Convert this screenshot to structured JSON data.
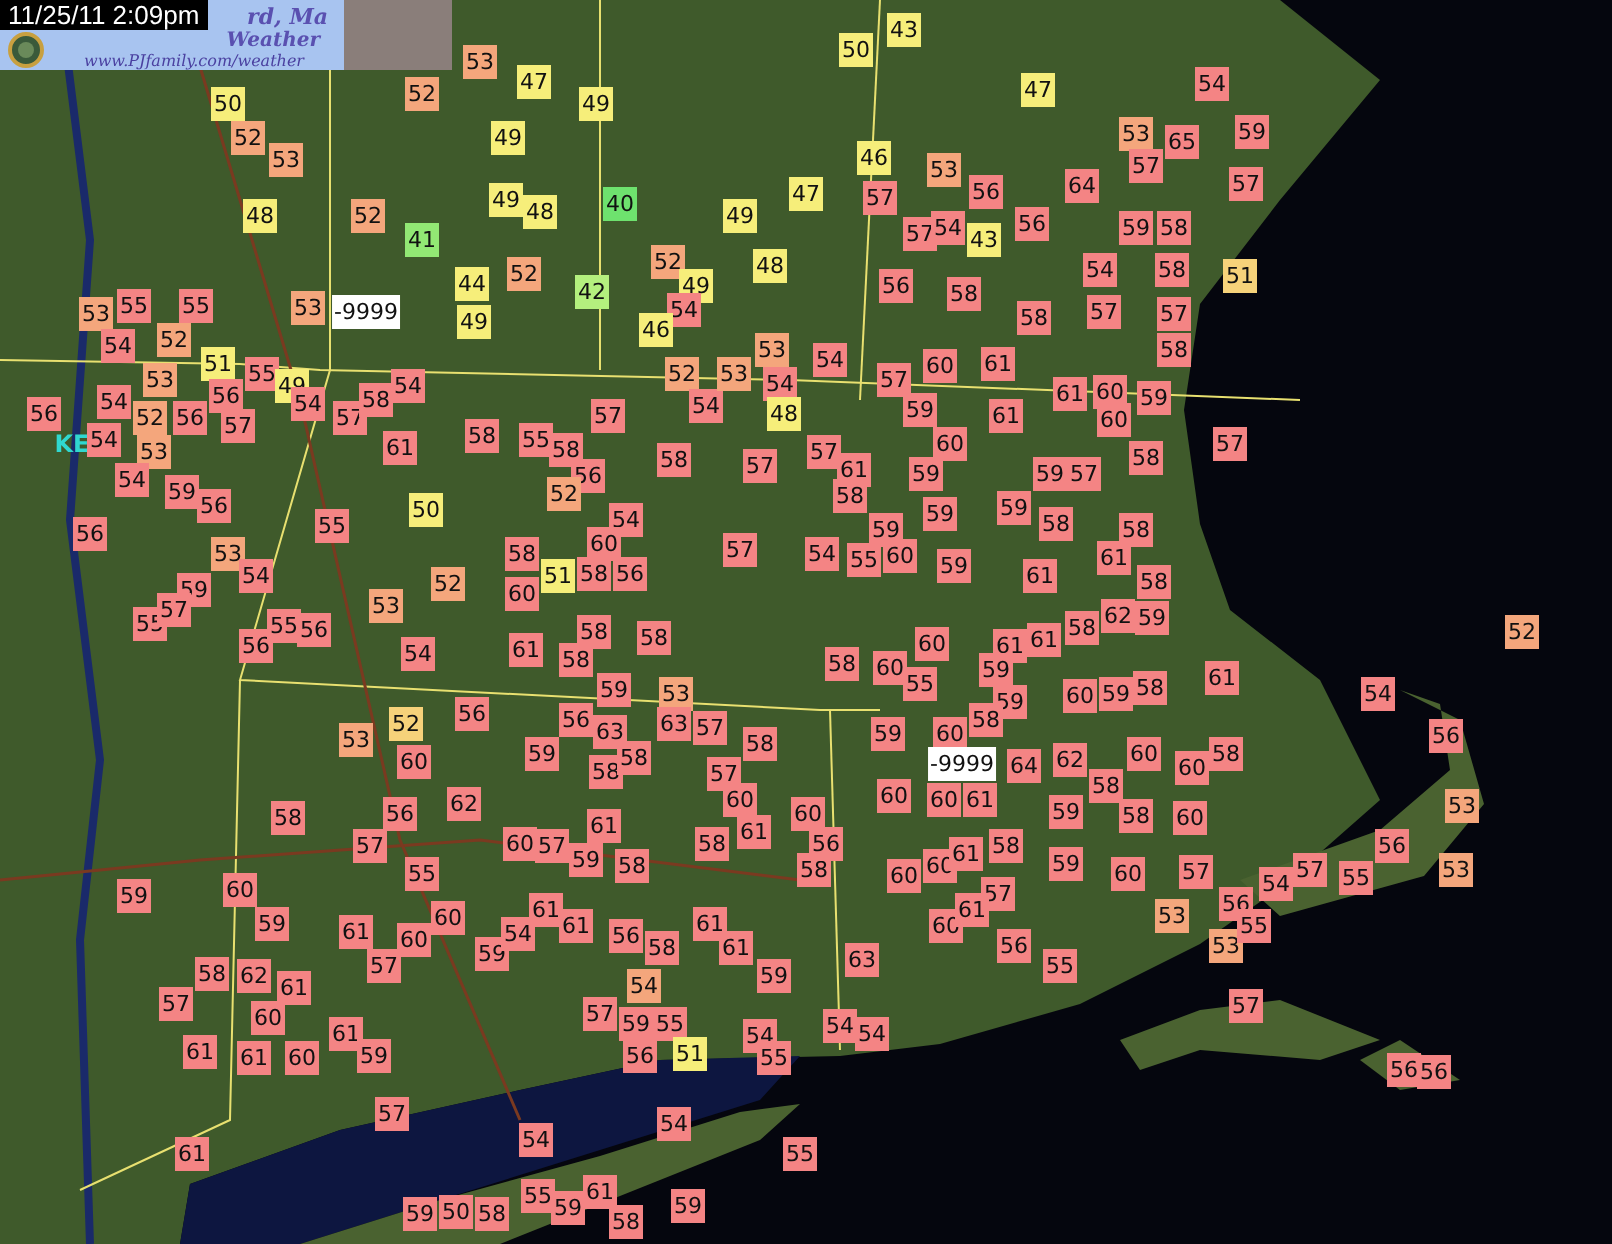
{
  "timestamp": "11/25/11 2:09pm",
  "banner": {
    "title": "rd, Ma",
    "subtitle": "Weather",
    "url": "www.PJfamily.com/weather"
  },
  "map_labels": [
    {
      "text": "KE"
    }
  ],
  "stations": [
    {
      "value": "53",
      "color": "#f4a67c"
    },
    {
      "value": "47",
      "color": "#f6ee7a"
    },
    {
      "value": "50",
      "color": "#f6ee7a"
    },
    {
      "value": "49",
      "color": "#f6ee7a"
    },
    {
      "value": "52",
      "color": "#f4a67c"
    },
    {
      "value": "53",
      "color": "#f4a67c"
    },
    {
      "value": "52",
      "color": "#f4a67c"
    },
    {
      "value": "49",
      "color": "#f6ee7a"
    },
    {
      "value": "48",
      "color": "#f6ee7a"
    },
    {
      "value": "52",
      "color": "#f4a67c"
    },
    {
      "value": "41",
      "color": "#92e874"
    },
    {
      "value": "49",
      "color": "#f6ee7a"
    },
    {
      "value": "48",
      "color": "#f6ee7a"
    },
    {
      "value": "40",
      "color": "#6ee26e"
    },
    {
      "value": "44",
      "color": "#f6ee7a"
    },
    {
      "value": "49",
      "color": "#f6ee7a"
    },
    {
      "value": "52",
      "color": "#f4a67c"
    },
    {
      "value": "42",
      "color": "#b4f07e"
    },
    {
      "value": "52",
      "color": "#f4a67c"
    },
    {
      "value": "49",
      "color": "#f6ee7a"
    },
    {
      "value": "54",
      "color": "#f48484"
    },
    {
      "value": "46",
      "color": "#f6ee7a"
    },
    {
      "value": "49",
      "color": "#f6ee7a"
    },
    {
      "value": "48",
      "color": "#f6ee7a"
    },
    {
      "value": "47",
      "color": "#f6ee7a"
    },
    {
      "value": "50",
      "color": "#f6ee7a"
    },
    {
      "value": "43",
      "color": "#f6ee7a"
    },
    {
      "value": "47",
      "color": "#f6ee7a"
    },
    {
      "value": "46",
      "color": "#f6ee7a"
    },
    {
      "value": "53",
      "color": "#f4a67c"
    },
    {
      "value": "57",
      "color": "#f48484"
    },
    {
      "value": "56",
      "color": "#f48484"
    },
    {
      "value": "57",
      "color": "#f48484"
    },
    {
      "value": "54",
      "color": "#f48484"
    },
    {
      "value": "43",
      "color": "#f6ee7a"
    },
    {
      "value": "56",
      "color": "#f48484"
    },
    {
      "value": "64",
      "color": "#f48484"
    },
    {
      "value": "53",
      "color": "#f4a67c"
    },
    {
      "value": "65",
      "color": "#f48484"
    },
    {
      "value": "54",
      "color": "#f48484"
    },
    {
      "value": "59",
      "color": "#f48484"
    },
    {
      "value": "57",
      "color": "#f48484"
    },
    {
      "value": "57",
      "color": "#f48484"
    },
    {
      "value": "59",
      "color": "#f48484"
    },
    {
      "value": "58",
      "color": "#f48484"
    },
    {
      "value": "54",
      "color": "#f48484"
    },
    {
      "value": "58",
      "color": "#f48484"
    },
    {
      "value": "51",
      "color": "#f6d27a"
    },
    {
      "value": "57",
      "color": "#f48484"
    },
    {
      "value": "56",
      "color": "#f48484"
    },
    {
      "value": "58",
      "color": "#f48484"
    },
    {
      "value": "58",
      "color": "#f48484"
    },
    {
      "value": "57",
      "color": "#f48484"
    },
    {
      "value": "54",
      "color": "#f48484"
    },
    {
      "value": "57",
      "color": "#f48484"
    },
    {
      "value": "60",
      "color": "#f48484"
    },
    {
      "value": "61",
      "color": "#f48484"
    },
    {
      "value": "58",
      "color": "#f48484"
    },
    {
      "value": "59",
      "color": "#f48484"
    },
    {
      "value": "61",
      "color": "#f48484"
    },
    {
      "value": "61",
      "color": "#f48484"
    },
    {
      "value": "60",
      "color": "#f48484"
    },
    {
      "value": "60",
      "color": "#f48484"
    },
    {
      "value": "59",
      "color": "#f48484"
    },
    {
      "value": "57",
      "color": "#f48484"
    },
    {
      "value": "61",
      "color": "#f48484"
    },
    {
      "value": "59",
      "color": "#f48484"
    },
    {
      "value": "60",
      "color": "#f48484"
    },
    {
      "value": "59",
      "color": "#f48484"
    },
    {
      "value": "57",
      "color": "#f48484"
    },
    {
      "value": "58",
      "color": "#f48484"
    },
    {
      "value": "57",
      "color": "#f48484"
    },
    {
      "value": "58",
      "color": "#f48484"
    },
    {
      "value": "59",
      "color": "#f48484"
    },
    {
      "value": "59",
      "color": "#f48484"
    },
    {
      "value": "59",
      "color": "#f48484"
    },
    {
      "value": "58",
      "color": "#f48484"
    },
    {
      "value": "58",
      "color": "#f48484"
    },
    {
      "value": "54",
      "color": "#f48484"
    },
    {
      "value": "55",
      "color": "#f48484"
    },
    {
      "value": "60",
      "color": "#f48484"
    },
    {
      "value": "59",
      "color": "#f48484"
    },
    {
      "value": "61",
      "color": "#f48484"
    },
    {
      "value": "61",
      "color": "#f48484"
    },
    {
      "value": "58",
      "color": "#f48484"
    },
    {
      "value": "53",
      "color": "#f4a67c"
    },
    {
      "value": "55",
      "color": "#f48484"
    },
    {
      "value": "55",
      "color": "#f48484"
    },
    {
      "value": "53",
      "color": "#f4a67c"
    },
    {
      "value": "-9999",
      "color": "#ffffff"
    },
    {
      "value": "54",
      "color": "#f48484"
    },
    {
      "value": "52",
      "color": "#f4a67c"
    },
    {
      "value": "53",
      "color": "#f4a67c"
    },
    {
      "value": "51",
      "color": "#f6ee7a"
    },
    {
      "value": "55",
      "color": "#f48484"
    },
    {
      "value": "49",
      "color": "#f6ee7a"
    },
    {
      "value": "56",
      "color": "#f48484"
    },
    {
      "value": "54",
      "color": "#f48484"
    },
    {
      "value": "54",
      "color": "#f48484"
    },
    {
      "value": "52",
      "color": "#f4a67c"
    },
    {
      "value": "53",
      "color": "#f4a67c"
    },
    {
      "value": "56",
      "color": "#f48484"
    },
    {
      "value": "56",
      "color": "#f48484"
    },
    {
      "value": "57",
      "color": "#f48484"
    },
    {
      "value": "54",
      "color": "#f48484"
    },
    {
      "value": "59",
      "color": "#f48484"
    },
    {
      "value": "56",
      "color": "#f48484"
    },
    {
      "value": "56",
      "color": "#f48484"
    },
    {
      "value": "53",
      "color": "#f4a67c"
    },
    {
      "value": "59",
      "color": "#f48484"
    },
    {
      "value": "54",
      "color": "#f48484"
    },
    {
      "value": "54",
      "color": "#f48484"
    },
    {
      "value": "57",
      "color": "#f48484"
    },
    {
      "value": "58",
      "color": "#f48484"
    },
    {
      "value": "54",
      "color": "#f48484"
    },
    {
      "value": "57",
      "color": "#f48484"
    },
    {
      "value": "52",
      "color": "#f4a67c"
    },
    {
      "value": "54",
      "color": "#f48484"
    },
    {
      "value": "53",
      "color": "#f4a67c"
    },
    {
      "value": "53",
      "color": "#f4a67c"
    },
    {
      "value": "54",
      "color": "#f48484"
    },
    {
      "value": "48",
      "color": "#f6ee7a"
    },
    {
      "value": "61",
      "color": "#f48484"
    },
    {
      "value": "58",
      "color": "#f48484"
    },
    {
      "value": "55",
      "color": "#f48484"
    },
    {
      "value": "58",
      "color": "#f48484"
    },
    {
      "value": "56",
      "color": "#f48484"
    },
    {
      "value": "58",
      "color": "#f48484"
    },
    {
      "value": "57",
      "color": "#f48484"
    },
    {
      "value": "55",
      "color": "#f48484"
    },
    {
      "value": "50",
      "color": "#f6ee7a"
    },
    {
      "value": "52",
      "color": "#f4a67c"
    },
    {
      "value": "54",
      "color": "#f48484"
    },
    {
      "value": "58",
      "color": "#f48484"
    },
    {
      "value": "60",
      "color": "#f48484"
    },
    {
      "value": "57",
      "color": "#f48484"
    },
    {
      "value": "52",
      "color": "#f4a67c"
    },
    {
      "value": "60",
      "color": "#f48484"
    },
    {
      "value": "51",
      "color": "#f6ee7a"
    },
    {
      "value": "58",
      "color": "#f48484"
    },
    {
      "value": "56",
      "color": "#f48484"
    },
    {
      "value": "55",
      "color": "#f48484"
    },
    {
      "value": "57",
      "color": "#f48484"
    },
    {
      "value": "56",
      "color": "#f48484"
    },
    {
      "value": "55",
      "color": "#f48484"
    },
    {
      "value": "56",
      "color": "#f48484"
    },
    {
      "value": "53",
      "color": "#f4a67c"
    },
    {
      "value": "54",
      "color": "#f48484"
    },
    {
      "value": "61",
      "color": "#f48484"
    },
    {
      "value": "58",
      "color": "#f48484"
    },
    {
      "value": "58",
      "color": "#f48484"
    },
    {
      "value": "58",
      "color": "#f48484"
    },
    {
      "value": "59",
      "color": "#f48484"
    },
    {
      "value": "53",
      "color": "#f4a67c"
    },
    {
      "value": "53",
      "color": "#f4a67c"
    },
    {
      "value": "52",
      "color": "#f6d27a"
    },
    {
      "value": "60",
      "color": "#f48484"
    },
    {
      "value": "56",
      "color": "#f48484"
    },
    {
      "value": "59",
      "color": "#f48484"
    },
    {
      "value": "56",
      "color": "#f48484"
    },
    {
      "value": "63",
      "color": "#f48484"
    },
    {
      "value": "58",
      "color": "#f48484"
    },
    {
      "value": "58",
      "color": "#f48484"
    },
    {
      "value": "63",
      "color": "#f48484"
    },
    {
      "value": "57",
      "color": "#f48484"
    },
    {
      "value": "58",
      "color": "#f48484"
    },
    {
      "value": "57",
      "color": "#f48484"
    },
    {
      "value": "58",
      "color": "#f48484"
    },
    {
      "value": "57",
      "color": "#f48484"
    },
    {
      "value": "56",
      "color": "#f48484"
    },
    {
      "value": "55",
      "color": "#f48484"
    },
    {
      "value": "62",
      "color": "#f48484"
    },
    {
      "value": "60",
      "color": "#f48484"
    },
    {
      "value": "57",
      "color": "#f48484"
    },
    {
      "value": "61",
      "color": "#f48484"
    },
    {
      "value": "59",
      "color": "#f48484"
    },
    {
      "value": "58",
      "color": "#f48484"
    },
    {
      "value": "58",
      "color": "#f48484"
    },
    {
      "value": "60",
      "color": "#f48484"
    },
    {
      "value": "61",
      "color": "#f48484"
    },
    {
      "value": "59",
      "color": "#f48484"
    },
    {
      "value": "60",
      "color": "#f48484"
    },
    {
      "value": "59",
      "color": "#f48484"
    },
    {
      "value": "61",
      "color": "#f48484"
    },
    {
      "value": "60",
      "color": "#f48484"
    },
    {
      "value": "60",
      "color": "#f48484"
    },
    {
      "value": "59",
      "color": "#f48484"
    },
    {
      "value": "54",
      "color": "#f48484"
    },
    {
      "value": "61",
      "color": "#f48484"
    },
    {
      "value": "61",
      "color": "#f48484"
    },
    {
      "value": "56",
      "color": "#f48484"
    },
    {
      "value": "58",
      "color": "#f48484"
    },
    {
      "value": "61",
      "color": "#f48484"
    },
    {
      "value": "61",
      "color": "#f48484"
    },
    {
      "value": "57",
      "color": "#f48484"
    },
    {
      "value": "58",
      "color": "#f48484"
    },
    {
      "value": "62",
      "color": "#f48484"
    },
    {
      "value": "61",
      "color": "#f48484"
    },
    {
      "value": "57",
      "color": "#f48484"
    },
    {
      "value": "54",
      "color": "#f4a67c"
    },
    {
      "value": "59",
      "color": "#f48484"
    },
    {
      "value": "61",
      "color": "#f48484"
    },
    {
      "value": "60",
      "color": "#f48484"
    },
    {
      "value": "61",
      "color": "#f48484"
    },
    {
      "value": "60",
      "color": "#f48484"
    },
    {
      "value": "61",
      "color": "#f48484"
    },
    {
      "value": "59",
      "color": "#f48484"
    },
    {
      "value": "57",
      "color": "#f48484"
    },
    {
      "value": "59",
      "color": "#f48484"
    },
    {
      "value": "56",
      "color": "#f48484"
    },
    {
      "value": "55",
      "color": "#f48484"
    },
    {
      "value": "51",
      "color": "#f6ee7a"
    },
    {
      "value": "54",
      "color": "#f48484"
    },
    {
      "value": "55",
      "color": "#f48484"
    },
    {
      "value": "61",
      "color": "#f48484"
    },
    {
      "value": "57",
      "color": "#f48484"
    },
    {
      "value": "54",
      "color": "#f48484"
    },
    {
      "value": "54",
      "color": "#f48484"
    },
    {
      "value": "55",
      "color": "#f48484"
    },
    {
      "value": "59",
      "color": "#f48484"
    },
    {
      "value": "50",
      "color": "#f48484"
    },
    {
      "value": "58",
      "color": "#f48484"
    },
    {
      "value": "55",
      "color": "#f48484"
    },
    {
      "value": "59",
      "color": "#f48484"
    },
    {
      "value": "61",
      "color": "#f48484"
    },
    {
      "value": "58",
      "color": "#f48484"
    },
    {
      "value": "59",
      "color": "#f48484"
    },
    {
      "value": "60",
      "color": "#f48484"
    },
    {
      "value": "61",
      "color": "#f48484"
    },
    {
      "value": "61",
      "color": "#f48484"
    },
    {
      "value": "58",
      "color": "#f48484"
    },
    {
      "value": "62",
      "color": "#f48484"
    },
    {
      "value": "59",
      "color": "#f48484"
    },
    {
      "value": "52",
      "color": "#f4a67c"
    },
    {
      "value": "58",
      "color": "#f48484"
    },
    {
      "value": "60",
      "color": "#f48484"
    },
    {
      "value": "55",
      "color": "#f48484"
    },
    {
      "value": "59",
      "color": "#f48484"
    },
    {
      "value": "59",
      "color": "#f48484"
    },
    {
      "value": "60",
      "color": "#f48484"
    },
    {
      "value": "59",
      "color": "#f48484"
    },
    {
      "value": "58",
      "color": "#f48484"
    },
    {
      "value": "61",
      "color": "#f48484"
    },
    {
      "value": "54",
      "color": "#f48484"
    },
    {
      "value": "59",
      "color": "#f48484"
    },
    {
      "value": "60",
      "color": "#f48484"
    },
    {
      "value": "58",
      "color": "#f48484"
    },
    {
      "value": "-9999",
      "color": "#ffffff"
    },
    {
      "value": "64",
      "color": "#f48484"
    },
    {
      "value": "62",
      "color": "#f48484"
    },
    {
      "value": "58",
      "color": "#f48484"
    },
    {
      "value": "60",
      "color": "#f48484"
    },
    {
      "value": "60",
      "color": "#f48484"
    },
    {
      "value": "58",
      "color": "#f48484"
    },
    {
      "value": "56",
      "color": "#f48484"
    },
    {
      "value": "60",
      "color": "#f48484"
    },
    {
      "value": "60",
      "color": "#f48484"
    },
    {
      "value": "60",
      "color": "#f48484"
    },
    {
      "value": "61",
      "color": "#f48484"
    },
    {
      "value": "59",
      "color": "#f48484"
    },
    {
      "value": "58",
      "color": "#f48484"
    },
    {
      "value": "60",
      "color": "#f48484"
    },
    {
      "value": "53",
      "color": "#f4a67c"
    },
    {
      "value": "58",
      "color": "#f48484"
    },
    {
      "value": "56",
      "color": "#f48484"
    },
    {
      "value": "60",
      "color": "#f48484"
    },
    {
      "value": "60",
      "color": "#f48484"
    },
    {
      "value": "61",
      "color": "#f48484"
    },
    {
      "value": "58",
      "color": "#f48484"
    },
    {
      "value": "57",
      "color": "#f48484"
    },
    {
      "value": "59",
      "color": "#f48484"
    },
    {
      "value": "60",
      "color": "#f48484"
    },
    {
      "value": "57",
      "color": "#f48484"
    },
    {
      "value": "54",
      "color": "#f48484"
    },
    {
      "value": "57",
      "color": "#f48484"
    },
    {
      "value": "55",
      "color": "#f48484"
    },
    {
      "value": "56",
      "color": "#f48484"
    },
    {
      "value": "53",
      "color": "#f4a67c"
    },
    {
      "value": "63",
      "color": "#f48484"
    },
    {
      "value": "60",
      "color": "#f48484"
    },
    {
      "value": "61",
      "color": "#f48484"
    },
    {
      "value": "56",
      "color": "#f48484"
    },
    {
      "value": "55",
      "color": "#f48484"
    },
    {
      "value": "53",
      "color": "#f4a67c"
    },
    {
      "value": "56",
      "color": "#f48484"
    },
    {
      "value": "53",
      "color": "#f4a67c"
    },
    {
      "value": "55",
      "color": "#f48484"
    },
    {
      "value": "54",
      "color": "#f48484"
    },
    {
      "value": "54",
      "color": "#f48484"
    },
    {
      "value": "57",
      "color": "#f48484"
    },
    {
      "value": "56",
      "color": "#f48484"
    },
    {
      "value": "56",
      "color": "#f48484"
    }
  ]
}
